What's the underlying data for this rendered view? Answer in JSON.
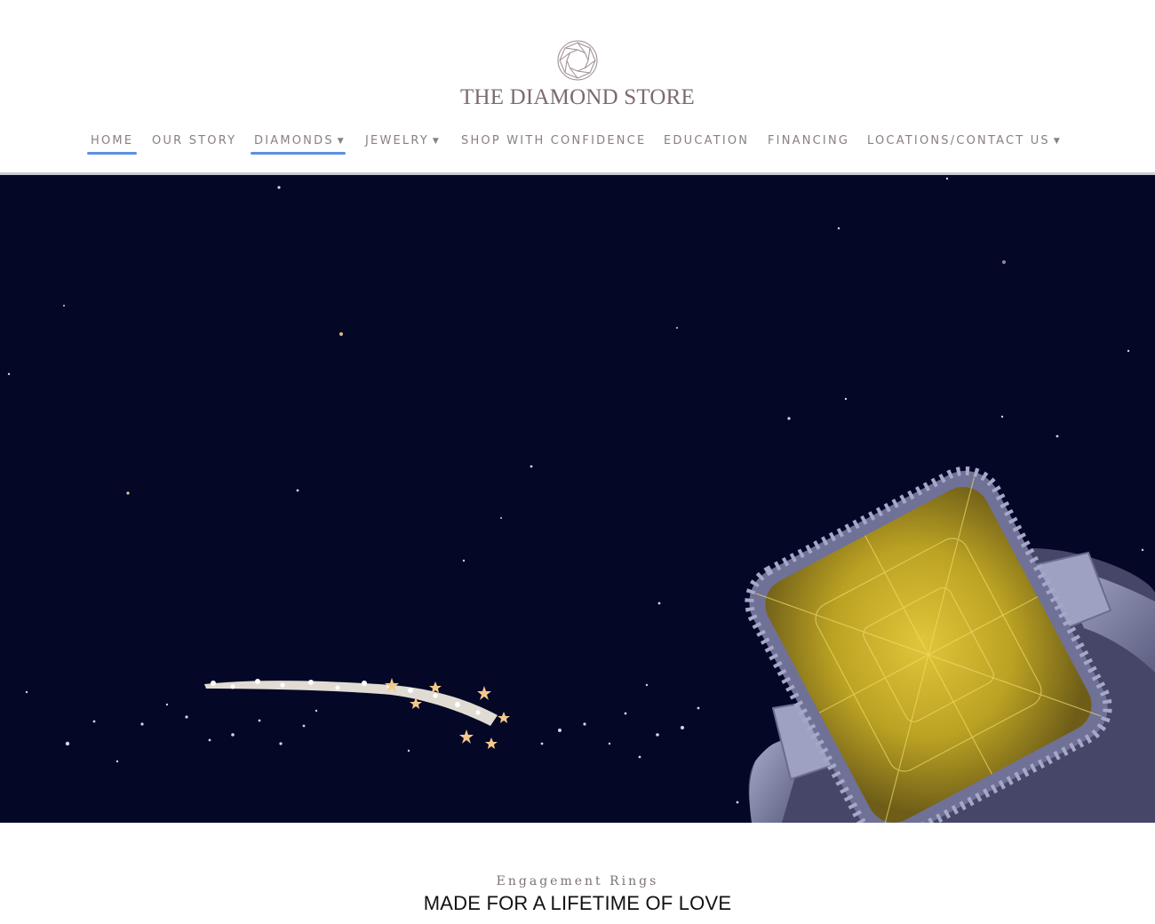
{
  "brand": {
    "name": "THE DIAMOND STORE",
    "logo_icon": "diamond-outline-icon"
  },
  "nav": {
    "items": [
      {
        "label": "HOME",
        "active": true,
        "dropdown": false
      },
      {
        "label": "OUR STORY",
        "active": false,
        "dropdown": false
      },
      {
        "label": "DIAMONDS",
        "active": true,
        "dropdown": true
      },
      {
        "label": "JEWELRY",
        "active": false,
        "dropdown": true
      },
      {
        "label": "SHOP WITH CONFIDENCE",
        "active": false,
        "dropdown": false
      },
      {
        "label": "EDUCATION",
        "active": false,
        "dropdown": false
      },
      {
        "label": "FINANCING",
        "active": false,
        "dropdown": false
      },
      {
        "label": "LOCATIONS/CONTACT US",
        "active": false,
        "dropdown": true
      }
    ],
    "caret_glyph": "▼"
  },
  "colors": {
    "accent_underline": "#5b8fe3",
    "brand_text": "#7d6a6e",
    "nav_text": "#8a7f82",
    "hero_background": "#050727",
    "yellow_diamond": "#c9b12a"
  },
  "hero": {
    "subject": "yellow-diamond-ring-image"
  },
  "section": {
    "eyebrow": "Engagement Rings",
    "headline": "MADE FOR A LIFETIME OF LOVE"
  }
}
